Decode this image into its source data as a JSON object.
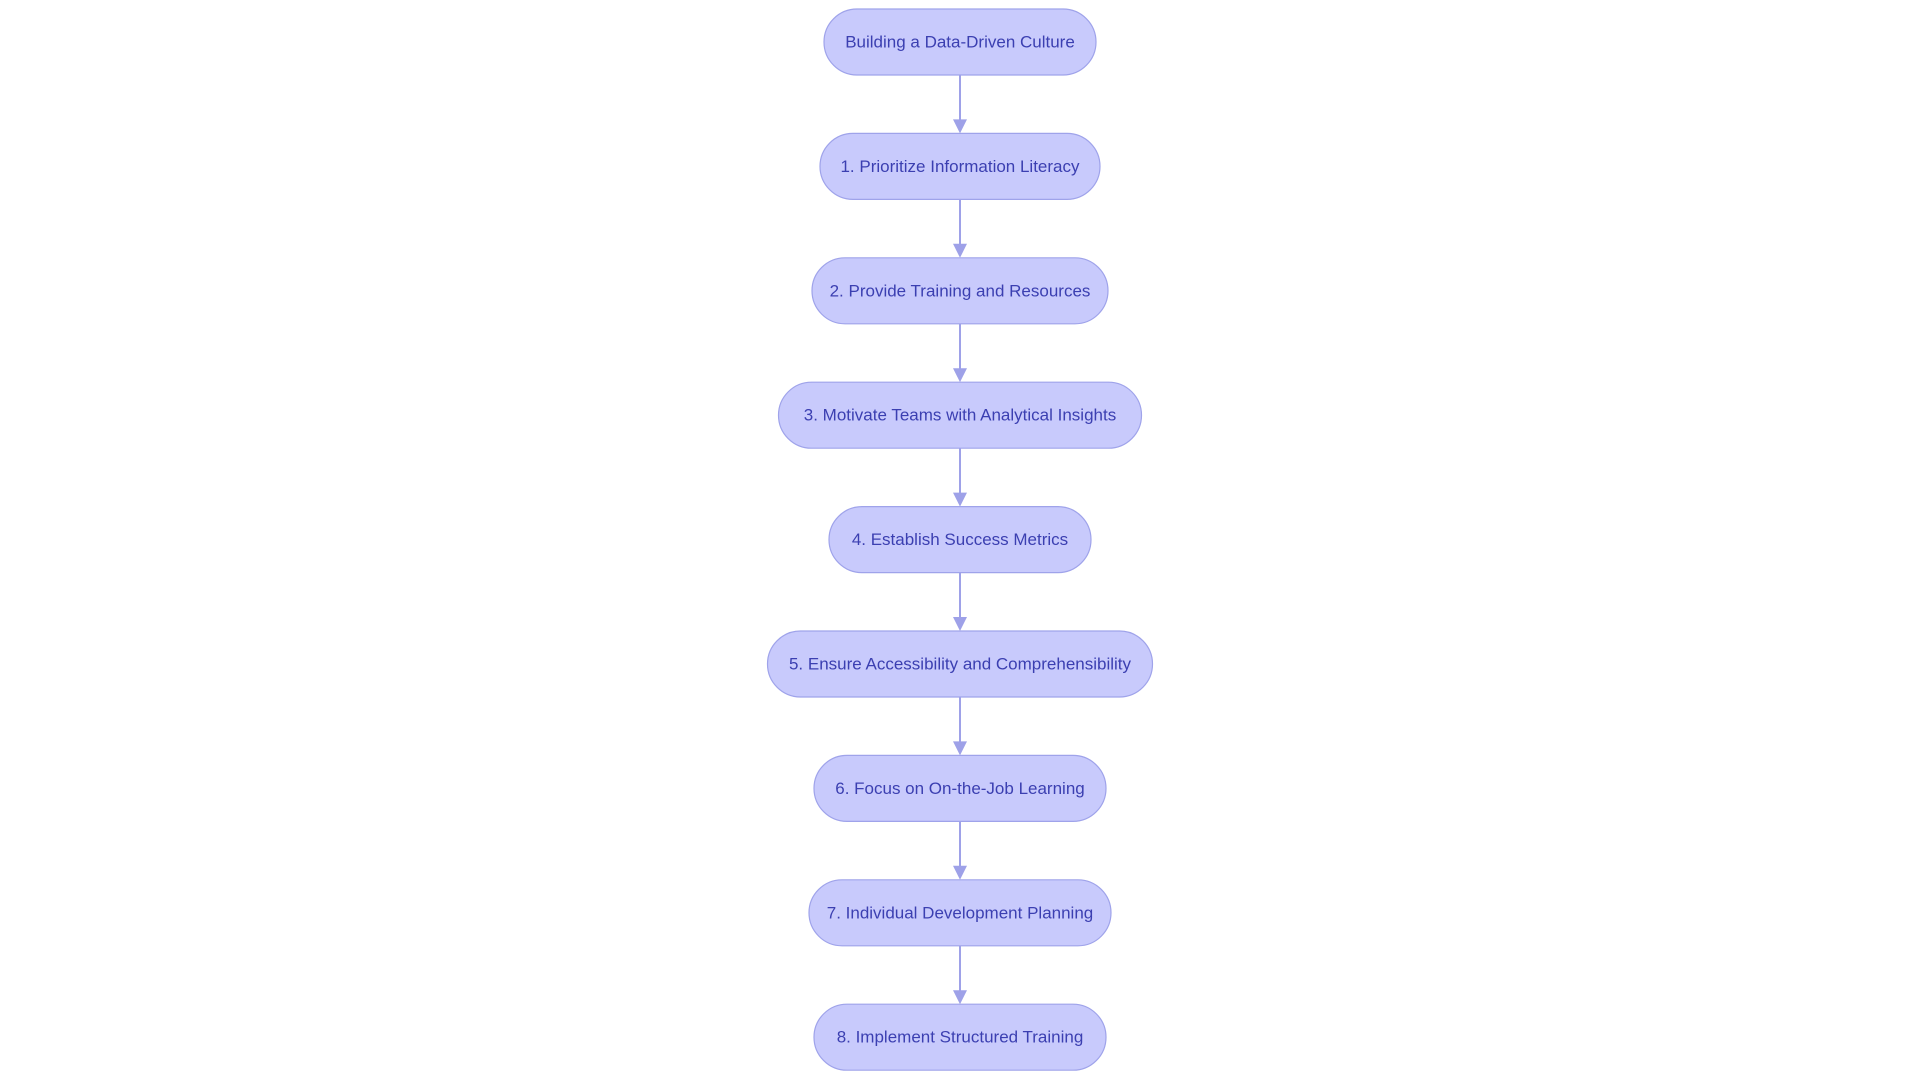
{
  "diagram": {
    "type": "flowchart",
    "direction": "top-to-bottom",
    "colors": {
      "node_fill": "#c8cafc",
      "node_border": "#9fa3ea",
      "node_text": "#3b3fb1",
      "edge": "#9ea1e8",
      "background": "#ffffff"
    },
    "nodes": [
      {
        "id": "root",
        "label": "Building a Data-Driven Culture"
      },
      {
        "id": "step1",
        "label": "1. Prioritize Information Literacy"
      },
      {
        "id": "step2",
        "label": "2. Provide Training and Resources"
      },
      {
        "id": "step3",
        "label": "3. Motivate Teams with Analytical Insights"
      },
      {
        "id": "step4",
        "label": "4. Establish Success Metrics"
      },
      {
        "id": "step5",
        "label": "5. Ensure Accessibility and Comprehensibility"
      },
      {
        "id": "step6",
        "label": "6. Focus on On-the-Job Learning"
      },
      {
        "id": "step7",
        "label": "7. Individual Development Planning"
      },
      {
        "id": "step8",
        "label": "8. Implement Structured Training"
      }
    ],
    "edges": [
      {
        "from": "root",
        "to": "step1"
      },
      {
        "from": "step1",
        "to": "step2"
      },
      {
        "from": "step2",
        "to": "step3"
      },
      {
        "from": "step3",
        "to": "step4"
      },
      {
        "from": "step4",
        "to": "step5"
      },
      {
        "from": "step5",
        "to": "step6"
      },
      {
        "from": "step6",
        "to": "step7"
      },
      {
        "from": "step7",
        "to": "step8"
      }
    ]
  }
}
